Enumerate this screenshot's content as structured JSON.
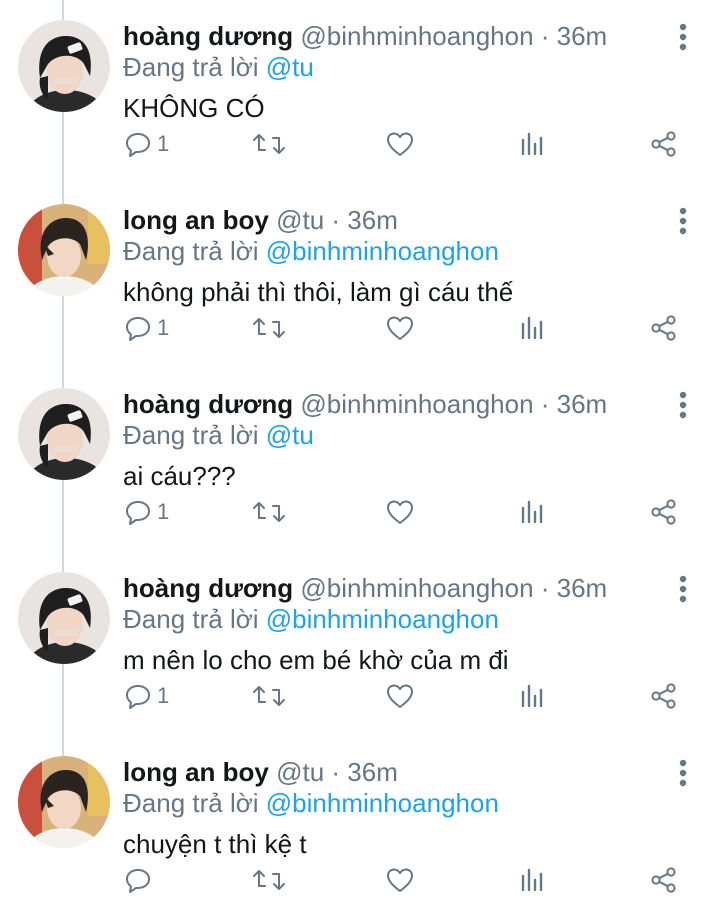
{
  "colors": {
    "name": "#14171a",
    "meta": "#657786",
    "mention": "#1da1f2",
    "thread_line": "#cfd9de"
  },
  "tweets": [
    {
      "avatar": "avatar-hoang-duong",
      "name": "hoàng dương",
      "meta": "@binhminhoanghon · 36m",
      "reply_prefix": "Đang trả lời ",
      "reply_to": "@tu",
      "text": "KHÔNG CÓ",
      "reply_count": "1"
    },
    {
      "avatar": "avatar-long-an-boy",
      "name": "long an boy",
      "meta": "@tu · 36m",
      "reply_prefix": "Đang trả lời ",
      "reply_to": "@binhminhoanghon",
      "text": "không phải thì thôi, làm gì cáu thế",
      "reply_count": "1"
    },
    {
      "avatar": "avatar-hoang-duong",
      "name": "hoàng dương",
      "meta": "@binhminhoanghon · 36m",
      "reply_prefix": "Đang trả lời ",
      "reply_to": "@tu",
      "text": "ai cáu???",
      "reply_count": "1"
    },
    {
      "avatar": "avatar-hoang-duong",
      "name": "hoàng dương",
      "meta": "@binhminhoanghon · 36m",
      "reply_prefix": "Đang trả lời ",
      "reply_to": "@binhminhoanghon",
      "text": "m nên lo cho em bé khờ của m đi",
      "reply_count": "1"
    },
    {
      "avatar": "avatar-long-an-boy",
      "name": "long an boy",
      "meta": "@tu · 36m",
      "reply_prefix": "Đang trả lời ",
      "reply_to": "@binhminhoanghon",
      "text": "chuyện t thì kệ t",
      "reply_count": ""
    }
  ]
}
